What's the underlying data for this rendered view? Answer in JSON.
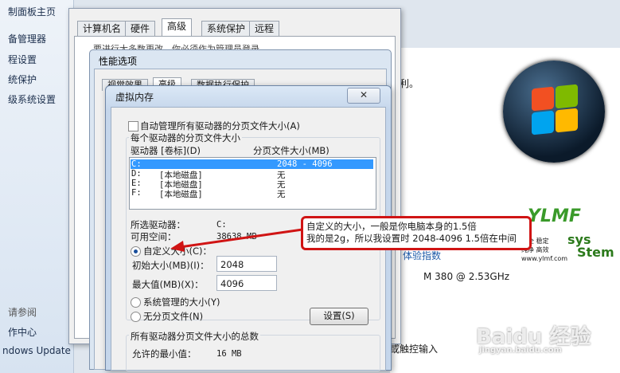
{
  "left_panel": {
    "items": [
      "制面板主页",
      "备管理器",
      "程设置",
      "统保护",
      "级系统设置"
    ],
    "see_also": "请参阅",
    "bottom_items": [
      "作中心",
      "ndows Update"
    ]
  },
  "sysprop": {
    "tabs": [
      "计算机名",
      "硬件",
      "高级",
      "系统保护",
      "远程"
    ],
    "notice": "要进行大多数更改，你必须作为管理员登录"
  },
  "background": {
    "rights_text": "权利。",
    "rating_link": "体验指数",
    "cpu": "M 380  @ 2.53GHz",
    "touch": "或触控输入",
    "ylmf": {
      "brand": "YLMF",
      "sys": "sys",
      "stem": "Stem",
      "tagline1": "安全 稳定",
      "tagline2": "纯净 高效",
      "url": "www.ylmf.com"
    }
  },
  "perf_dialog": {
    "title": "性能选项",
    "tabs": [
      "视觉效果",
      "高级",
      "数据执行保护"
    ]
  },
  "vm_dialog": {
    "title": "虚拟内存",
    "close": "✕",
    "auto_manage": "自动管理所有驱动器的分页文件大小(A)",
    "per_drive_group": "每个驱动器的分页文件大小",
    "col_drive": "驱动器 [卷标](D)",
    "col_size": "分页文件大小(MB)",
    "drives": [
      {
        "drive": "C:",
        "label": "",
        "size": "2048 - 4096",
        "selected": true
      },
      {
        "drive": "D:",
        "label": "[本地磁盘]",
        "size": "无",
        "selected": false
      },
      {
        "drive": "E:",
        "label": "[本地磁盘]",
        "size": "无",
        "selected": false
      },
      {
        "drive": "F:",
        "label": "[本地磁盘]",
        "size": "无",
        "selected": false
      }
    ],
    "selected_drive_label": "所选驱动器：",
    "selected_drive_value": "C:",
    "free_space_label": "可用空间：",
    "free_space_value": "38638 MB",
    "custom_size": "自定义大小(C)：",
    "initial_size_label": "初始大小(MB)(I)：",
    "initial_size_value": "2048",
    "max_size_label": "最大值(MB)(X)：",
    "max_size_value": "4096",
    "system_managed": "系统管理的大小(Y)",
    "no_paging": "无分页文件(N)",
    "set_button": "设置(S)",
    "total_group": "所有驱动器分页文件大小的总数",
    "min_allowed_label": "允许的最小值：",
    "min_allowed_value": "16 MB"
  },
  "callout": {
    "line1": "自定义的大小，一般是你电脑本身的1.5倍",
    "line2": "我的是2g，所以我设置时 2048-4096 1.5倍在中间"
  },
  "watermark": {
    "brand": "Baidu 经验",
    "url": "jingyan.baidu.com"
  },
  "colors": {
    "callout_border": "#d01414",
    "selection": "#3399ff"
  }
}
